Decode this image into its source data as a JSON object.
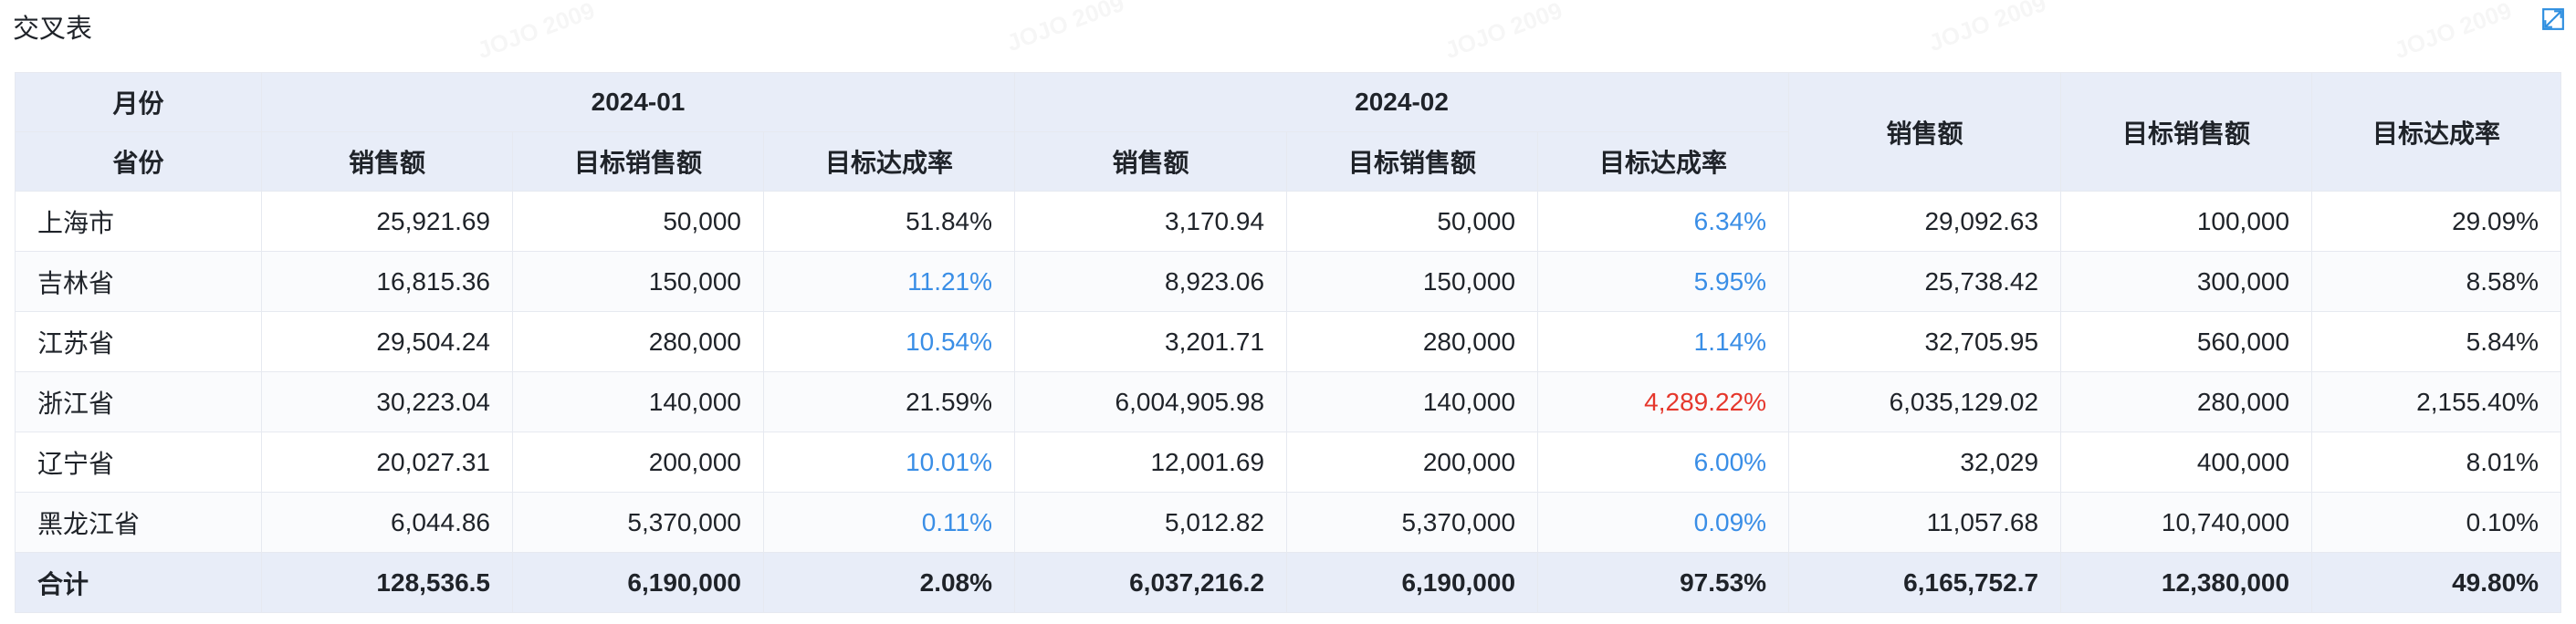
{
  "title": "交叉表",
  "watermark": "JOJO 2009",
  "header": {
    "corner_top": "月份",
    "corner_bottom": "省份",
    "groups": [
      "2024-01",
      "2024-02"
    ],
    "metrics": [
      "销售额",
      "目标销售额",
      "目标达成率"
    ],
    "total_metrics": [
      "销售额",
      "目标销售额",
      "目标达成率"
    ]
  },
  "rows": [
    {
      "province": "上海市",
      "cells": [
        "25,921.69",
        "50,000",
        "51.84%",
        "3,170.94",
        "50,000",
        "6.34%",
        "29,092.63",
        "100,000",
        "29.09%"
      ],
      "rate_status": [
        "normal",
        "low",
        "normal"
      ]
    },
    {
      "province": "吉林省",
      "cells": [
        "16,815.36",
        "150,000",
        "11.21%",
        "8,923.06",
        "150,000",
        "5.95%",
        "25,738.42",
        "300,000",
        "8.58%"
      ],
      "rate_status": [
        "low",
        "low",
        "normal"
      ]
    },
    {
      "province": "江苏省",
      "cells": [
        "29,504.24",
        "280,000",
        "10.54%",
        "3,201.71",
        "280,000",
        "1.14%",
        "32,705.95",
        "560,000",
        "5.84%"
      ],
      "rate_status": [
        "low",
        "low",
        "normal"
      ]
    },
    {
      "province": "浙江省",
      "cells": [
        "30,223.04",
        "140,000",
        "21.59%",
        "6,004,905.98",
        "140,000",
        "4,289.22%",
        "6,035,129.02",
        "280,000",
        "2,155.40%"
      ],
      "rate_status": [
        "normal",
        "high",
        "normal"
      ]
    },
    {
      "province": "辽宁省",
      "cells": [
        "20,027.31",
        "200,000",
        "10.01%",
        "12,001.69",
        "200,000",
        "6.00%",
        "32,029",
        "400,000",
        "8.01%"
      ],
      "rate_status": [
        "low",
        "low",
        "normal"
      ]
    },
    {
      "province": "黑龙江省",
      "cells": [
        "6,044.86",
        "5,370,000",
        "0.11%",
        "5,012.82",
        "5,370,000",
        "0.09%",
        "11,057.68",
        "10,740,000",
        "0.10%"
      ],
      "rate_status": [
        "low",
        "low",
        "normal"
      ]
    }
  ],
  "total": {
    "label": "合计",
    "cells": [
      "128,536.5",
      "6,190,000",
      "2.08%",
      "6,037,216.2",
      "6,190,000",
      "97.53%",
      "6,165,752.7",
      "12,380,000",
      "49.80%"
    ]
  },
  "colors": {
    "header_bg": "#e8edf8",
    "low_rate": "#3a8ee6",
    "high_rate": "#e5372c",
    "expand_icon": "#2f8fe0"
  }
}
